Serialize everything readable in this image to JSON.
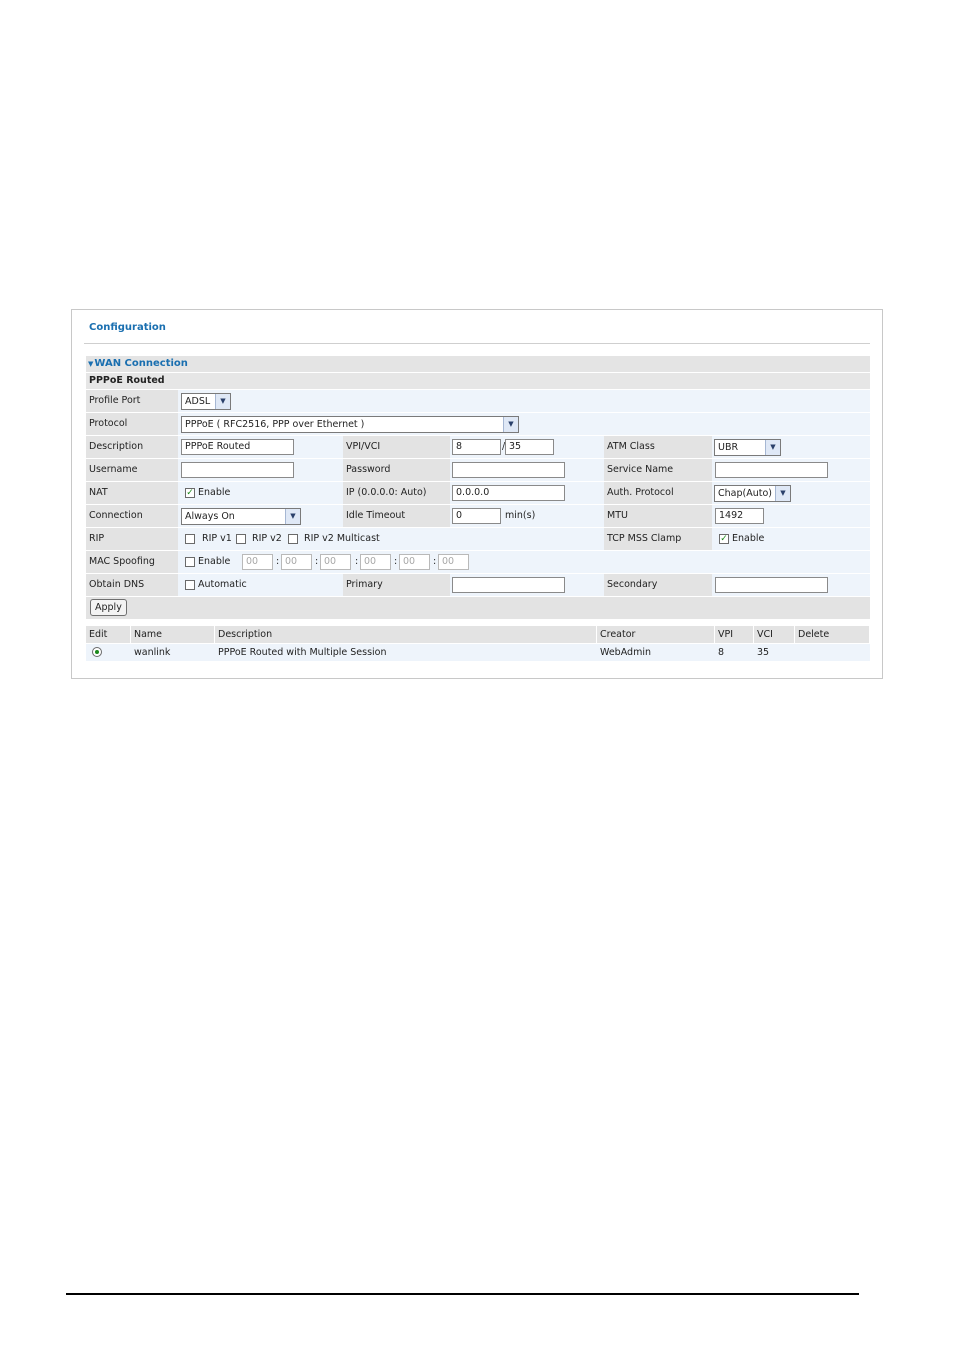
{
  "config": {
    "title": "Configuration"
  },
  "panel": {
    "title": "WAN Connection",
    "section": "PPPoE Routed"
  },
  "form": {
    "profile_port": {
      "label": "Profile Port",
      "value": "ADSL"
    },
    "protocol": {
      "label": "Protocol",
      "value": "PPPoE ( RFC2516, PPP over Ethernet )"
    },
    "description": {
      "label": "Description",
      "value": "PPPoE Routed"
    },
    "vpi_vci": {
      "label": "VPI/VCI",
      "vpi": "8",
      "vci": "35"
    },
    "atm_class": {
      "label": "ATM Class",
      "value": "UBR"
    },
    "username": {
      "label": "Username",
      "value": ""
    },
    "password": {
      "label": "Password",
      "value": ""
    },
    "service_name": {
      "label": "Service Name",
      "value": ""
    },
    "nat": {
      "label": "NAT",
      "checkbox_label": "Enable",
      "checked": true
    },
    "ip": {
      "label": "IP (0.0.0.0: Auto)",
      "value": "0.0.0.0"
    },
    "auth_protocol": {
      "label": "Auth. Protocol",
      "value": "Chap(Auto)"
    },
    "connection": {
      "label": "Connection",
      "value": "Always On"
    },
    "idle_timeout": {
      "label": "Idle Timeout",
      "value": "0",
      "unit": "min(s)"
    },
    "mtu": {
      "label": "MTU",
      "value": "1492"
    },
    "rip": {
      "label": "RIP",
      "options": [
        "RIP v1",
        "RIP v2",
        "RIP v2 Multicast"
      ]
    },
    "tcp_mss": {
      "label": "TCP MSS Clamp",
      "checkbox_label": "Enable",
      "checked": true
    },
    "mac_spoofing": {
      "label": "MAC Spoofing",
      "checkbox_label": "Enable",
      "octets": [
        "00",
        "00",
        "00",
        "00",
        "00",
        "00"
      ]
    },
    "obtain_dns": {
      "label": "Obtain DNS",
      "checkbox_label": "Automatic"
    },
    "primary": {
      "label": "Primary",
      "value": ""
    },
    "secondary": {
      "label": "Secondary",
      "value": ""
    },
    "apply_label": "Apply"
  },
  "table": {
    "headers": [
      "Edit",
      "Name",
      "Description",
      "Creator",
      "VPI",
      "VCI",
      "Delete"
    ],
    "rows": [
      {
        "name": "wanlink",
        "description": "PPPoE Routed with Multiple Session",
        "creator": "WebAdmin",
        "vpi": "8",
        "vci": "35"
      }
    ]
  },
  "colors": {
    "accent": "#1a6fb0",
    "row_bg": "#eef4fb",
    "label_bg": "#e3e3e3"
  }
}
